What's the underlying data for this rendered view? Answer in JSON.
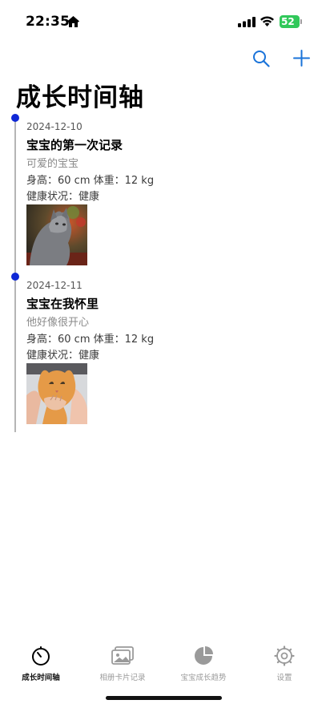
{
  "status_bar": {
    "time": "22:35",
    "battery": "52"
  },
  "header": {
    "title": "成长时间轴"
  },
  "entries": [
    {
      "date": "2024-12-10",
      "title": "宝宝的第一次记录",
      "description": "可爱的宝宝",
      "metrics": "身高：60 cm  体重：12 kg",
      "health": "健康状况：健康"
    },
    {
      "date": "2024-12-11",
      "title": "宝宝在我怀里",
      "description": "他好像很开心",
      "metrics": "身高：60 cm  体重：12 kg",
      "health": "健康状况：健康"
    }
  ],
  "tabs": [
    {
      "label": "成长时间轴",
      "icon": "timer-icon",
      "active": true
    },
    {
      "label": "相册卡片记录",
      "icon": "photo-album-icon",
      "active": false
    },
    {
      "label": "宝宝成长趋势",
      "icon": "pie-chart-icon",
      "active": false
    },
    {
      "label": "设置",
      "icon": "gear-icon",
      "active": false
    }
  ],
  "colors": {
    "accent": "#1a73d9",
    "timeline_dot": "#0f28d6",
    "battery": "#31c85a"
  }
}
